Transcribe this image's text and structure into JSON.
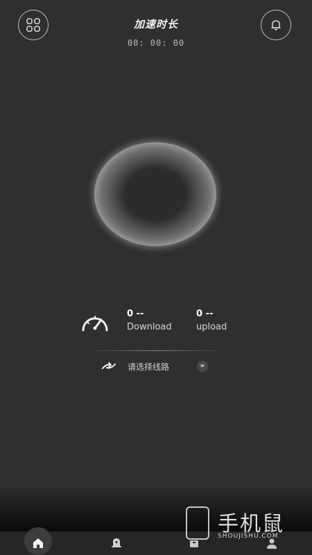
{
  "header": {
    "title": "加速时长",
    "timer": "00: 00: 00",
    "menu_icon": "grid-icon",
    "bell_icon": "bell-icon"
  },
  "stats": {
    "icon": "speedometer-icon",
    "download": {
      "value": "0 --",
      "label": "Download"
    },
    "upload": {
      "value": "0 --",
      "label": "upload"
    }
  },
  "route": {
    "icon": "route-icon",
    "label": "请选择线路",
    "arrow": "»"
  },
  "tabs": [
    {
      "icon": "home-icon",
      "active": true
    },
    {
      "icon": "alert-icon",
      "active": false
    },
    {
      "icon": "box-icon",
      "active": false
    },
    {
      "icon": "user-icon",
      "active": false
    }
  ],
  "watermark": {
    "text": "手机鼠",
    "sub": "SHOUJISHU.COM"
  }
}
